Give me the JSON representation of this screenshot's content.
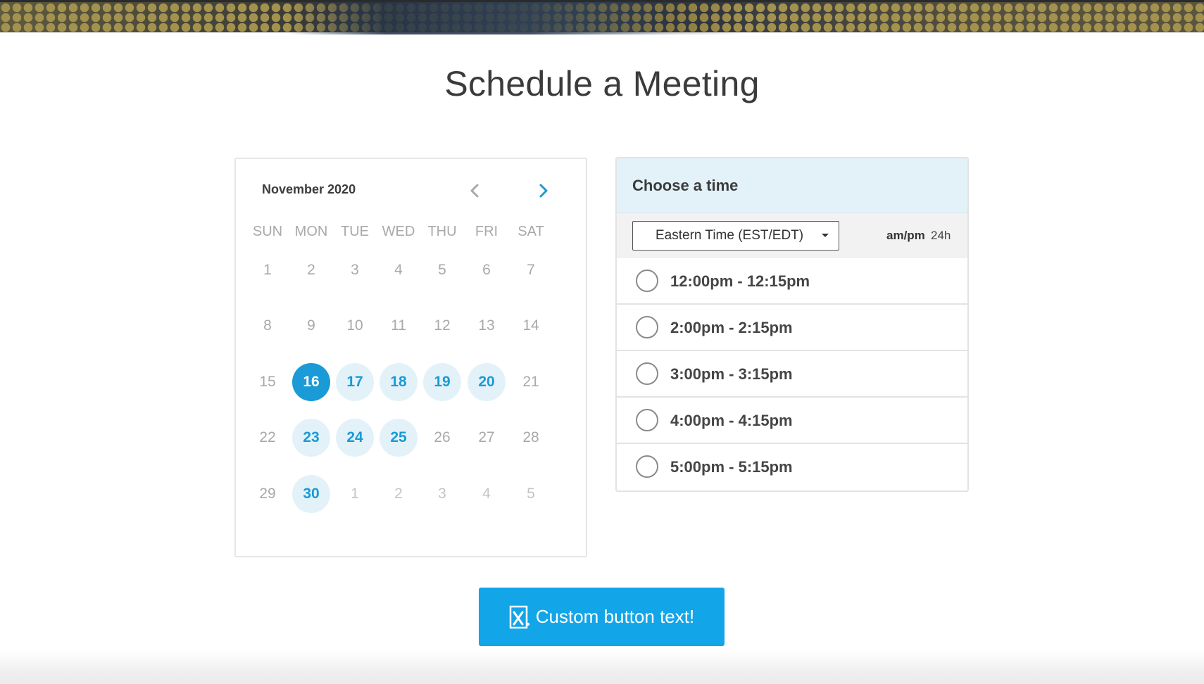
{
  "page": {
    "title": "Schedule a Meeting"
  },
  "calendar": {
    "month_label": "November 2020",
    "prev_icon": "chevron-left-icon",
    "next_icon": "chevron-right-icon",
    "weekdays": [
      "SUN",
      "MON",
      "TUE",
      "WED",
      "THU",
      "FRI",
      "SAT"
    ],
    "weeks": [
      [
        {
          "label": "1",
          "state": "unavailable"
        },
        {
          "label": "2",
          "state": "unavailable"
        },
        {
          "label": "3",
          "state": "unavailable"
        },
        {
          "label": "4",
          "state": "unavailable"
        },
        {
          "label": "5",
          "state": "unavailable"
        },
        {
          "label": "6",
          "state": "unavailable"
        },
        {
          "label": "7",
          "state": "unavailable"
        }
      ],
      [
        {
          "label": "8",
          "state": "unavailable"
        },
        {
          "label": "9",
          "state": "unavailable"
        },
        {
          "label": "10",
          "state": "unavailable"
        },
        {
          "label": "11",
          "state": "unavailable"
        },
        {
          "label": "12",
          "state": "unavailable"
        },
        {
          "label": "13",
          "state": "unavailable"
        },
        {
          "label": "14",
          "state": "unavailable"
        }
      ],
      [
        {
          "label": "15",
          "state": "unavailable"
        },
        {
          "label": "16",
          "state": "selected"
        },
        {
          "label": "17",
          "state": "available"
        },
        {
          "label": "18",
          "state": "available"
        },
        {
          "label": "19",
          "state": "available"
        },
        {
          "label": "20",
          "state": "available"
        },
        {
          "label": "21",
          "state": "unavailable"
        }
      ],
      [
        {
          "label": "22",
          "state": "unavailable"
        },
        {
          "label": "23",
          "state": "available"
        },
        {
          "label": "24",
          "state": "available"
        },
        {
          "label": "25",
          "state": "available"
        },
        {
          "label": "26",
          "state": "unavailable"
        },
        {
          "label": "27",
          "state": "unavailable"
        },
        {
          "label": "28",
          "state": "unavailable"
        }
      ],
      [
        {
          "label": "29",
          "state": "unavailable"
        },
        {
          "label": "30",
          "state": "available"
        },
        {
          "label": "1",
          "state": "other-month"
        },
        {
          "label": "2",
          "state": "other-month"
        },
        {
          "label": "3",
          "state": "other-month"
        },
        {
          "label": "4",
          "state": "other-month"
        },
        {
          "label": "5",
          "state": "other-month"
        }
      ]
    ]
  },
  "time_picker": {
    "header": "Choose a time",
    "timezone": "Eastern Time (EST/EDT)",
    "format_ampm": "am/pm",
    "format_24h": "24h",
    "slots": [
      "12:00pm - 12:15pm",
      "2:00pm - 2:15pm",
      "3:00pm - 3:15pm",
      "4:00pm - 4:15pm",
      "5:00pm - 5:15pm"
    ]
  },
  "submit": {
    "label": "Custom button text!",
    "icon": "x-logo-icon"
  },
  "colors": {
    "accent": "#12a5e8",
    "day_available_bg": "#e3f2f9",
    "day_selected_bg": "#1a9ad6",
    "muted_text": "#a9a9a9",
    "panel_header_bg": "#e3f2f9"
  }
}
